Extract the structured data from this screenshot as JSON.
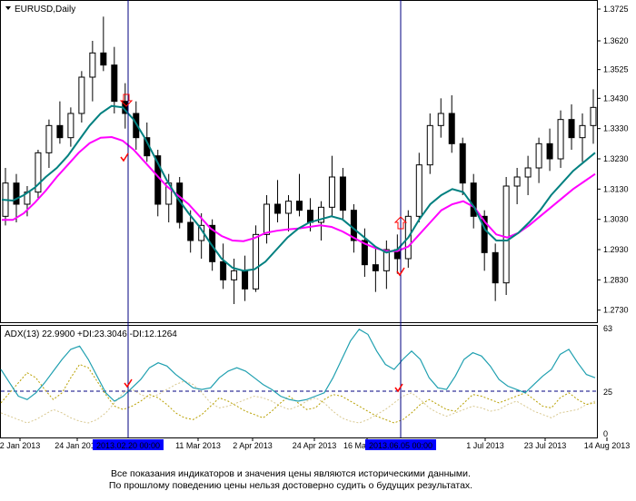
{
  "chart_data": [
    {
      "type": "candlestick",
      "title": "EURUSD,Daily",
      "ylim": [
        1.269,
        1.3755
      ],
      "y_ticks": [
        "1.3725",
        "1.3620",
        "1.3525",
        "1.3430",
        "1.3330",
        "1.3230",
        "1.3130",
        "1.3030",
        "1.2930",
        "1.2830",
        "1.2730"
      ],
      "x_ticks": [
        "2 Jan 2013",
        "24 Jan 2013",
        "11 Mar 2013",
        "2 Apr 2013",
        "24 Apr 2013",
        "16 May 2013",
        "1 Jul 2013",
        "23 Jul 2013",
        "14 Aug 2013"
      ],
      "crosshair_labels": [
        "2013.02.20 00:00",
        "2013.06.05 00:00"
      ],
      "colors": {
        "candle": "#000000",
        "ma_fast": "#008080",
        "ma_slow": "#ff00ff",
        "crosshair": "#000080",
        "label_bg": "#0000ff",
        "signal": "#ff0000"
      },
      "series": [
        {
          "key": "ma_fast",
          "values": [
            1.3095,
            1.3092,
            1.311,
            1.3135,
            1.317,
            1.32,
            1.324,
            1.329,
            1.334,
            1.338,
            1.3405,
            1.34,
            1.336,
            1.33,
            1.323,
            1.316,
            1.31,
            1.305,
            1.3005,
            1.295,
            1.29,
            1.287,
            1.286,
            1.2865,
            1.289,
            1.293,
            1.297,
            1.3,
            1.302,
            1.303,
            1.304,
            1.303,
            1.3,
            1.297,
            1.294,
            1.292,
            1.293,
            1.297,
            1.303,
            1.308,
            1.311,
            1.313,
            1.312,
            1.307,
            1.2995,
            1.296,
            1.296,
            1.2985,
            1.302,
            1.306,
            1.311,
            1.315,
            1.319,
            1.322,
            1.325
          ]
        },
        {
          "key": "ma_slow",
          "values": [
            1.3028,
            1.3028,
            1.305,
            1.3085,
            1.3125,
            1.317,
            1.321,
            1.325,
            1.3282,
            1.33,
            1.3302,
            1.329,
            1.326,
            1.322,
            1.318,
            1.314,
            1.311,
            1.308,
            1.304,
            1.3,
            1.2975,
            1.296,
            1.2958,
            1.2968,
            1.2985,
            1.2992,
            1.2997,
            1.3,
            1.3005,
            1.301,
            1.3005,
            1.299,
            1.297,
            1.295,
            1.2935,
            1.2925,
            1.2925,
            1.294,
            1.298,
            1.302,
            1.306,
            1.308,
            1.309,
            1.307,
            1.302,
            1.298,
            1.297,
            1.2985,
            1.301,
            1.304,
            1.307,
            1.31,
            1.313,
            1.3155,
            1.318
          ]
        },
        {
          "key": "candles",
          "ohlc": [
            [
              1.304,
              1.32,
              1.301,
              1.315
            ],
            [
              1.315,
              1.318,
              1.302,
              1.308
            ],
            [
              1.308,
              1.314,
              1.304,
              1.312
            ],
            [
              1.312,
              1.326,
              1.31,
              1.325
            ],
            [
              1.325,
              1.336,
              1.32,
              1.334
            ],
            [
              1.334,
              1.342,
              1.328,
              1.33
            ],
            [
              1.33,
              1.34,
              1.327,
              1.338
            ],
            [
              1.338,
              1.352,
              1.335,
              1.35
            ],
            [
              1.35,
              1.362,
              1.342,
              1.358
            ],
            [
              1.358,
              1.37,
              1.352,
              1.354
            ],
            [
              1.354,
              1.36,
              1.338,
              1.342
            ],
            [
              1.342,
              1.348,
              1.333,
              1.338
            ],
            [
              1.338,
              1.342,
              1.326,
              1.33
            ],
            [
              1.33,
              1.335,
              1.322,
              1.324
            ],
            [
              1.324,
              1.326,
              1.304,
              1.308
            ],
            [
              1.308,
              1.318,
              1.302,
              1.315
            ],
            [
              1.315,
              1.317,
              1.3,
              1.302
            ],
            [
              1.302,
              1.306,
              1.292,
              1.296
            ],
            [
              1.296,
              1.305,
              1.29,
              1.301
            ],
            [
              1.301,
              1.303,
              1.286,
              1.289
            ],
            [
              1.289,
              1.295,
              1.28,
              1.283
            ],
            [
              1.283,
              1.29,
              1.275,
              1.286
            ],
            [
              1.286,
              1.291,
              1.276,
              1.28
            ],
            [
              1.28,
              1.301,
              1.279,
              1.298
            ],
            [
              1.298,
              1.311,
              1.295,
              1.308
            ],
            [
              1.308,
              1.316,
              1.302,
              1.305
            ],
            [
              1.305,
              1.311,
              1.299,
              1.309
            ],
            [
              1.309,
              1.318,
              1.304,
              1.306
            ],
            [
              1.306,
              1.31,
              1.299,
              1.302
            ],
            [
              1.302,
              1.309,
              1.296,
              1.307
            ],
            [
              1.307,
              1.324,
              1.304,
              1.317
            ],
            [
              1.317,
              1.32,
              1.303,
              1.306
            ],
            [
              1.306,
              1.308,
              1.292,
              1.296
            ],
            [
              1.296,
              1.3,
              1.284,
              1.288
            ],
            [
              1.288,
              1.294,
              1.279,
              1.286
            ],
            [
              1.286,
              1.296,
              1.28,
              1.293
            ],
            [
              1.293,
              1.298,
              1.285,
              1.29
            ],
            [
              1.29,
              1.306,
              1.287,
              1.304
            ],
            [
              1.304,
              1.325,
              1.302,
              1.321
            ],
            [
              1.321,
              1.338,
              1.318,
              1.334
            ],
            [
              1.334,
              1.343,
              1.33,
              1.338
            ],
            [
              1.338,
              1.344,
              1.325,
              1.328
            ],
            [
              1.328,
              1.33,
              1.311,
              1.315
            ],
            [
              1.315,
              1.318,
              1.3,
              1.304
            ],
            [
              1.304,
              1.306,
              1.286,
              1.292
            ],
            [
              1.292,
              1.295,
              1.276,
              1.282
            ],
            [
              1.282,
              1.317,
              1.278,
              1.314
            ],
            [
              1.314,
              1.32,
              1.308,
              1.317
            ],
            [
              1.317,
              1.324,
              1.311,
              1.32
            ],
            [
              1.32,
              1.33,
              1.315,
              1.328
            ],
            [
              1.328,
              1.333,
              1.319,
              1.323
            ],
            [
              1.323,
              1.339,
              1.32,
              1.336
            ],
            [
              1.336,
              1.341,
              1.326,
              1.33
            ],
            [
              1.33,
              1.338,
              1.322,
              1.334
            ],
            [
              1.334,
              1.346,
              1.328,
              1.34
            ]
          ]
        }
      ]
    },
    {
      "type": "line",
      "title": "ADX(13) 22.9900 +DI:23.3046 -DI:12.1264",
      "ylim": [
        0,
        63
      ],
      "y_ticks": [
        "63",
        "25",
        "0"
      ],
      "level": 25,
      "colors": {
        "adx": "#20a0b0",
        "plus_di": "#b8a000",
        "minus_di": "#d8c890",
        "level": "#000080"
      },
      "series": [
        {
          "key": "adx",
          "values": [
            38,
            30,
            22,
            20,
            24,
            30,
            37,
            44,
            50,
            52,
            44,
            34,
            24,
            19,
            22,
            27,
            32,
            39,
            42,
            40,
            35,
            31,
            27,
            26,
            27,
            33,
            37,
            39,
            37,
            33,
            29,
            26,
            22,
            20,
            19,
            20,
            22,
            24,
            33,
            44,
            55,
            62,
            59,
            49,
            41,
            38,
            44,
            49,
            44,
            33,
            27,
            26,
            34,
            44,
            48,
            46,
            40,
            32,
            28,
            26,
            24,
            29,
            34,
            38,
            47,
            50,
            42,
            35,
            33
          ]
        },
        {
          "key": "plus_di",
          "values": [
            18,
            24,
            30,
            36,
            33,
            26,
            20,
            24,
            33,
            41,
            39,
            31,
            23,
            16,
            14,
            16,
            19,
            23,
            21,
            17,
            12,
            9,
            8,
            11,
            16,
            21,
            19,
            16,
            13,
            11,
            9,
            13,
            18,
            22,
            18,
            14,
            15,
            20,
            23,
            22,
            19,
            16,
            13,
            10,
            8,
            6,
            8,
            12,
            17,
            20,
            17,
            14,
            13,
            18,
            23,
            22,
            20,
            18,
            20,
            22,
            24,
            20,
            16,
            15,
            21,
            24,
            20,
            17,
            18
          ]
        },
        {
          "key": "minus_di",
          "values": [
            12,
            10,
            8,
            6,
            8,
            11,
            14,
            12,
            9,
            7,
            6,
            8,
            12,
            18,
            24,
            26,
            23,
            21,
            23,
            26,
            29,
            31,
            29,
            24,
            18,
            15,
            16,
            18,
            20,
            22,
            21,
            19,
            16,
            14,
            16,
            19,
            21,
            18,
            13,
            9,
            7,
            6,
            8,
            11,
            14,
            18,
            22,
            24,
            20,
            15,
            12,
            10,
            12,
            14,
            16,
            15,
            13,
            14,
            17,
            19,
            16,
            13,
            11,
            9,
            12,
            13,
            14,
            17,
            19
          ]
        }
      ]
    }
  ],
  "disclaimer": {
    "line1": "Все показания индикаторов и значения цены являются историческими данными.",
    "line2": "По прошлому поведению цены нельзя достоверно судить о будущих результатах."
  }
}
